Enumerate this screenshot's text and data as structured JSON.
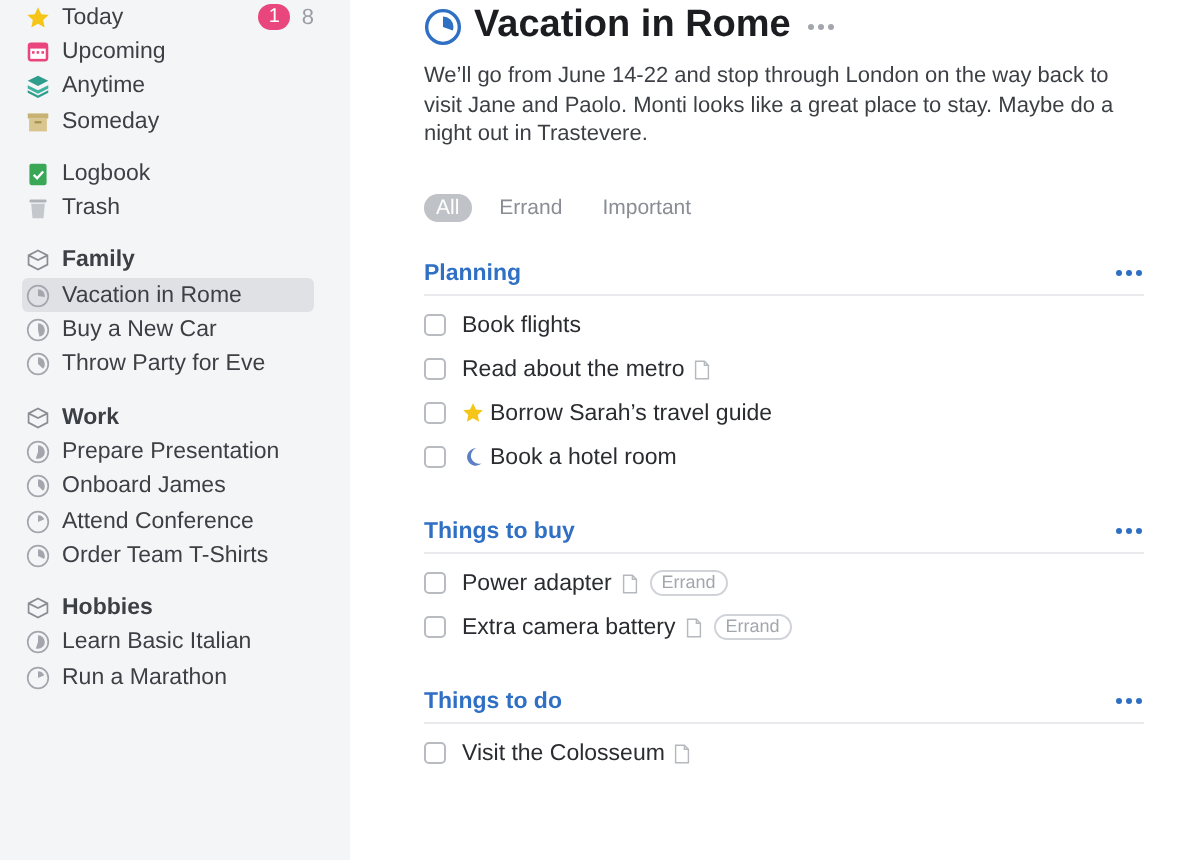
{
  "sidebar": {
    "lists": [
      {
        "label": "Today",
        "kind": "today",
        "badge": "1",
        "count": "8"
      },
      {
        "label": "Upcoming",
        "kind": "upcoming"
      },
      {
        "label": "Anytime",
        "kind": "anytime"
      },
      {
        "label": "Someday",
        "kind": "someday"
      }
    ],
    "archive": [
      {
        "label": "Logbook",
        "kind": "logbook"
      },
      {
        "label": "Trash",
        "kind": "trash"
      }
    ],
    "areas": [
      {
        "label": "Family",
        "projects": [
          {
            "label": "Vacation in Rome",
            "level": 0.3,
            "selected": true
          },
          {
            "label": "Buy a New Car",
            "level": 0.5,
            "selected": false
          },
          {
            "label": "Throw Party for Eve",
            "level": 0.4,
            "selected": false
          }
        ]
      },
      {
        "label": "Work",
        "projects": [
          {
            "label": "Prepare Presentation",
            "level": 0.6,
            "selected": false
          },
          {
            "label": "Onboard James",
            "level": 0.4,
            "selected": false
          },
          {
            "label": "Attend Conference",
            "level": 0.2,
            "selected": false
          },
          {
            "label": "Order Team T-Shirts",
            "level": 0.35,
            "selected": false
          }
        ]
      },
      {
        "label": "Hobbies",
        "projects": [
          {
            "label": "Learn Basic Italian",
            "level": 0.6,
            "selected": false
          },
          {
            "label": "Run a Marathon",
            "level": 0.2,
            "selected": false
          }
        ]
      }
    ]
  },
  "project": {
    "title": "Vacation in Rome",
    "level": 0.3,
    "notes": "We’ll go from June 14-22 and stop through London on the way back to visit Jane and Paolo. Monti looks like a great place to stay. Maybe do a night out in Trastevere.",
    "filters": [
      {
        "label": "All",
        "selected": true
      },
      {
        "label": "Errand",
        "selected": false
      },
      {
        "label": "Important",
        "selected": false
      }
    ],
    "headings": [
      {
        "title": "Planning",
        "tasks": [
          {
            "title": "Book flights",
            "checked": false
          },
          {
            "title": "Read about the metro",
            "checked": false,
            "note": true
          },
          {
            "title": "Borrow Sarah’s travel guide",
            "checked": false,
            "today": true
          },
          {
            "title": "Book a hotel room",
            "checked": false,
            "evening": true
          }
        ]
      },
      {
        "title": "Things to buy",
        "tasks": [
          {
            "title": "Power adapter",
            "checked": false,
            "note": true,
            "tags": [
              "Errand"
            ]
          },
          {
            "title": "Extra camera battery",
            "checked": false,
            "note": true,
            "tags": [
              "Errand"
            ]
          }
        ]
      },
      {
        "title": "Things to do",
        "tasks": [
          {
            "title": "Visit the Colosseum",
            "checked": false,
            "note": true
          }
        ]
      }
    ]
  }
}
